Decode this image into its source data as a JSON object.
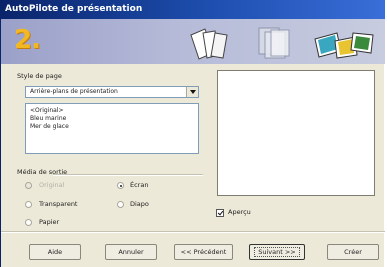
{
  "window": {
    "title": "AutoPilote de présentation"
  },
  "banner": {
    "step": "2."
  },
  "page_style": {
    "label": "Style de page",
    "selected": "Arrière-plans de présentation",
    "items": [
      "<Original>",
      "Bleu marine",
      "Mer de glace"
    ]
  },
  "output_media": {
    "label": "Média de sortie",
    "options": {
      "original": "Original",
      "transparent": "Transparent",
      "paper": "Papier",
      "screen": "Écran",
      "slide": "Diapo"
    },
    "selected": "Écran"
  },
  "preview": {
    "checkbox_label": "Aperçu",
    "checked": true
  },
  "buttons": {
    "help": "Aide",
    "cancel": "Annuler",
    "previous": "<< Précédent",
    "next": "Suivant >>",
    "create": "Créer"
  },
  "colors": {
    "title_bar": "#0a246a",
    "step_number": "#f2b824",
    "dialog_background": "#ece9d8"
  }
}
